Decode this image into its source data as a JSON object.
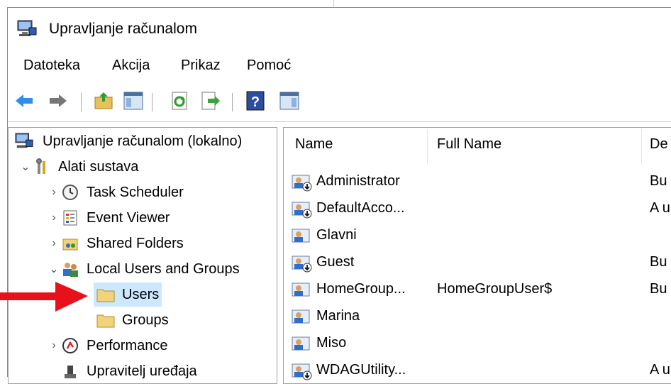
{
  "window": {
    "title": "Upravljanje računalom"
  },
  "menu": [
    "Datoteka",
    "Akcija",
    "Prikaz",
    "Pomoć"
  ],
  "toolbar_icons": [
    "back-arrow-icon",
    "forward-arrow-icon",
    "up-folder-icon",
    "show-hide-tree-icon",
    "refresh-icon",
    "export-list-icon",
    "help-icon",
    "show-hide-action-icon"
  ],
  "tree": {
    "root": "Upravljanje računalom (lokalno)",
    "system_tools": "Alati sustava",
    "task_scheduler": "Task Scheduler",
    "event_viewer": "Event Viewer",
    "shared_folders": "Shared Folders",
    "local_users": "Local Users and Groups",
    "users": "Users",
    "groups": "Groups",
    "performance": "Performance",
    "device_manager": "Upravitelj uređaja"
  },
  "columns": {
    "name": "Name",
    "full_name": "Full Name",
    "description": "De"
  },
  "users": [
    {
      "name": "Administrator",
      "full": "",
      "desc": "Bu",
      "disabled": true
    },
    {
      "name": "DefaultAcco...",
      "full": "",
      "desc": "A u",
      "disabled": true
    },
    {
      "name": "Glavni",
      "full": "",
      "desc": "",
      "disabled": false
    },
    {
      "name": "Guest",
      "full": "",
      "desc": "Bu",
      "disabled": true
    },
    {
      "name": "HomeGroup...",
      "full": "HomeGroupUser$",
      "desc": "Bu",
      "disabled": false
    },
    {
      "name": "Marina",
      "full": "",
      "desc": "",
      "disabled": false
    },
    {
      "name": "Miso",
      "full": "",
      "desc": "",
      "disabled": false
    },
    {
      "name": "WDAGUtility...",
      "full": "",
      "desc": "A u",
      "disabled": true
    }
  ],
  "colors": {
    "selection": "#cce8ff",
    "arrow": "#e8101a",
    "folder": "#f3d37a",
    "user_blue": "#2f6fc9"
  }
}
